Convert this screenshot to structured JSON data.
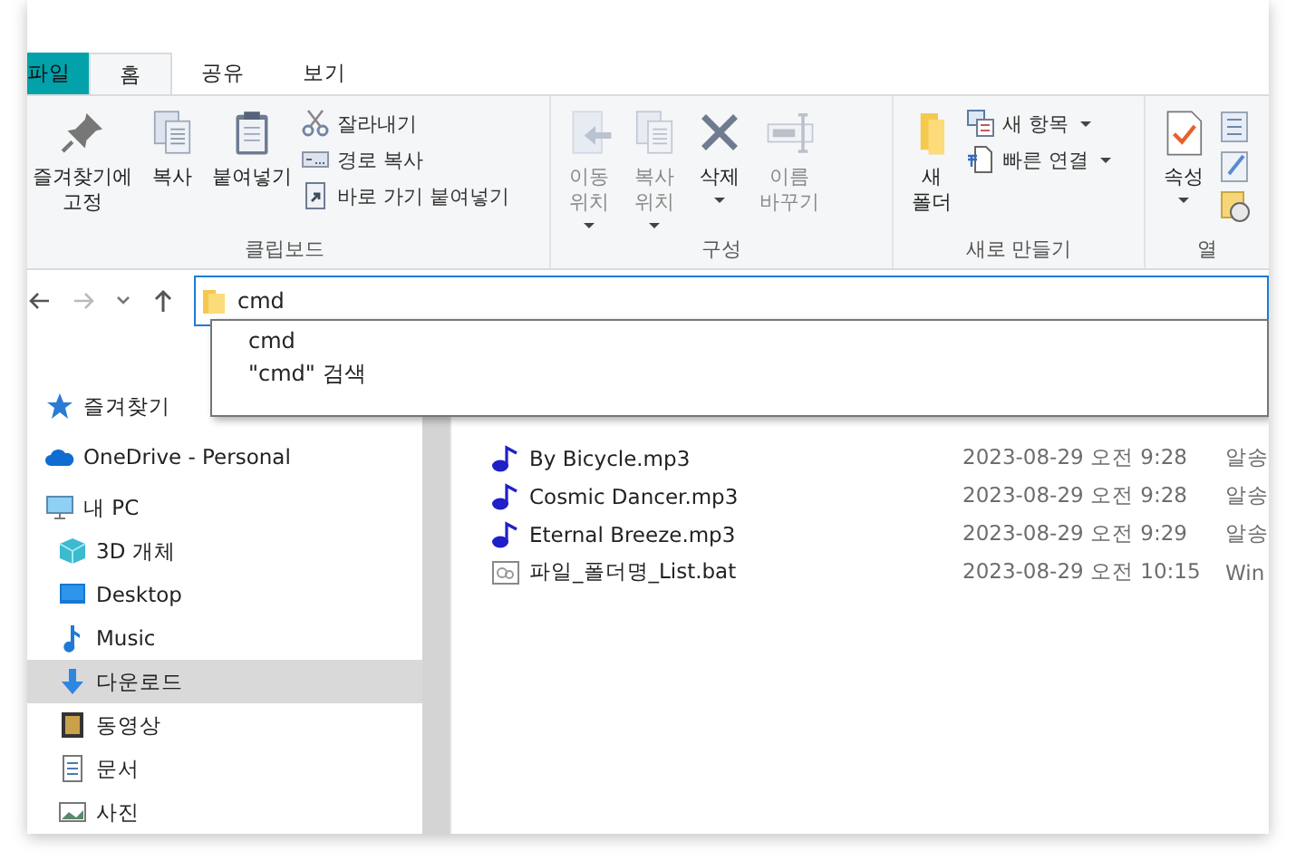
{
  "ribbon": {
    "tabs": [
      {
        "label": "파일",
        "kind": "file",
        "selected": false
      },
      {
        "label": "홈",
        "kind": "tab",
        "selected": true
      },
      {
        "label": "공유",
        "kind": "tab",
        "selected": false
      },
      {
        "label": "보기",
        "kind": "tab",
        "selected": false
      }
    ],
    "groups": [
      {
        "label": "클립보드",
        "large": [
          {
            "kind": "pin",
            "label": "즐겨찾기에\n고정",
            "dropdown": false,
            "disabled": false
          },
          {
            "kind": "copy",
            "label": "복사",
            "dropdown": false,
            "disabled": false
          },
          {
            "kind": "paste",
            "label": "붙여넣기",
            "dropdown": false,
            "disabled": false
          }
        ],
        "small": [
          {
            "kind": "cut",
            "label": "잘라내기",
            "dropdown": false
          },
          {
            "kind": "copy-path",
            "label": "경로 복사",
            "dropdown": false
          },
          {
            "kind": "paste-shortcut",
            "label": "바로 가기 붙여넣기",
            "dropdown": false
          }
        ]
      },
      {
        "label": "구성",
        "large": [
          {
            "kind": "move",
            "label": "이동\n위치",
            "dropdown": true,
            "disabled": true
          },
          {
            "kind": "copy-to",
            "label": "복사\n위치",
            "dropdown": true,
            "disabled": true
          },
          {
            "kind": "delete",
            "label": "삭제",
            "dropdown": true,
            "disabled": false
          },
          {
            "kind": "rename",
            "label": "이름\n바꾸기",
            "dropdown": false,
            "disabled": true
          }
        ]
      },
      {
        "label": "새로 만들기",
        "large": [
          {
            "kind": "new-folder",
            "label": "새\n폴더",
            "dropdown": false,
            "disabled": false
          }
        ],
        "small": [
          {
            "kind": "new-item",
            "label": "새 항목",
            "dropdown": true
          },
          {
            "kind": "easy-access",
            "label": "빠른 연결",
            "dropdown": true
          }
        ]
      },
      {
        "label": "열",
        "large": [
          {
            "kind": "properties",
            "label": "속성",
            "dropdown": true,
            "disabled": false
          }
        ],
        "small": [
          {
            "kind": "open"
          }
        ]
      }
    ]
  },
  "address": {
    "value": "cmd",
    "suggestions": [
      "cmd",
      "\"cmd\" 검색"
    ]
  },
  "nav": [
    {
      "kind": "star",
      "label": "즐겨찾기",
      "selected": false
    },
    {
      "kind": "cloud",
      "label": "OneDrive - Personal",
      "selected": false
    },
    {
      "kind": "pc",
      "label": "내 PC",
      "selected": false
    },
    {
      "kind": "cube",
      "label": "3D 개체",
      "selected": false
    },
    {
      "kind": "desktop",
      "label": "Desktop",
      "selected": false
    },
    {
      "kind": "music",
      "label": "Music",
      "selected": false
    },
    {
      "kind": "download",
      "label": "다운로드",
      "selected": true
    },
    {
      "kind": "video",
      "label": "동영상",
      "selected": false
    },
    {
      "kind": "doc",
      "label": "문서",
      "selected": false
    },
    {
      "kind": "photo",
      "label": "사진",
      "selected": false
    }
  ],
  "files": [
    {
      "kind": "audio",
      "name": "By Bicycle.mp3",
      "date": "2023-08-29 오전 9:28",
      "type": "알송"
    },
    {
      "kind": "audio",
      "name": "Cosmic Dancer.mp3",
      "date": "2023-08-29 오전 9:28",
      "type": "알송"
    },
    {
      "kind": "audio",
      "name": "Eternal Breeze.mp3",
      "date": "2023-08-29 오전 9:29",
      "type": "알송"
    },
    {
      "kind": "batch",
      "name": "파일_폴더명_List.bat",
      "date": "2023-08-29 오전 10:15",
      "type": "Win"
    }
  ]
}
